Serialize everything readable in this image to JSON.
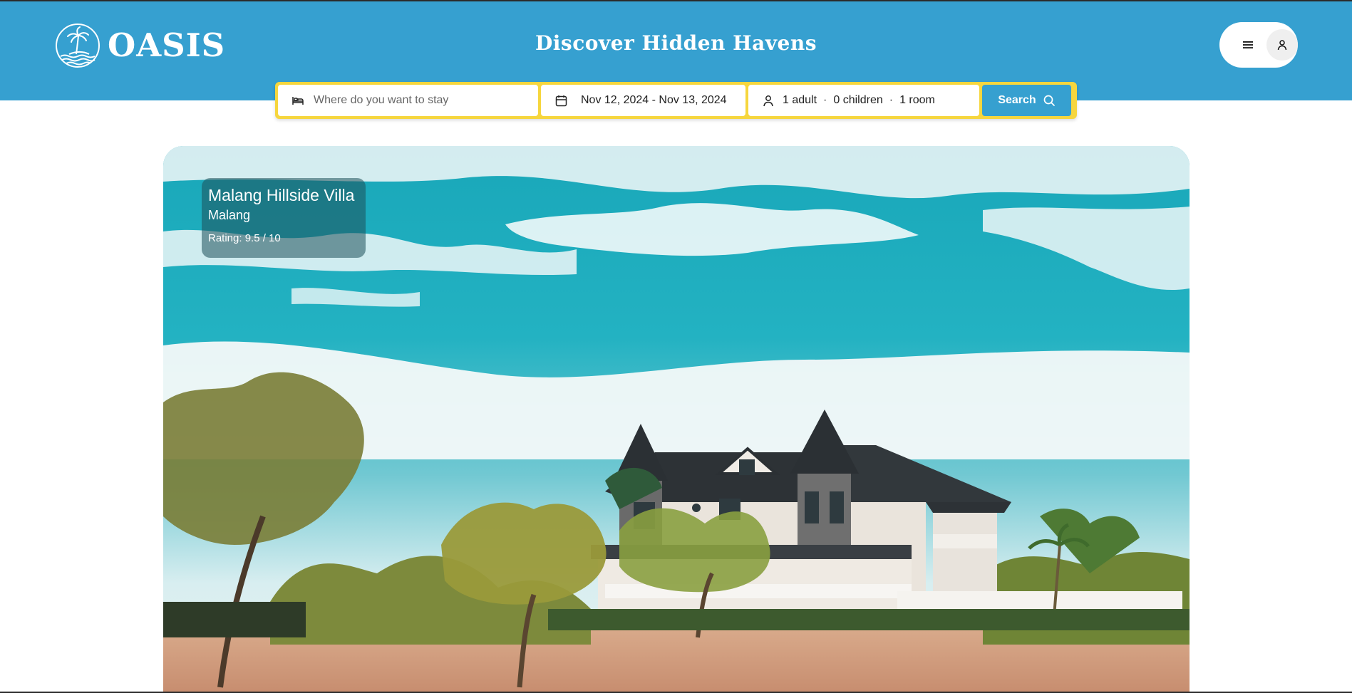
{
  "app": {
    "name": "OASIS",
    "page_title": "Discover Hidden Havens"
  },
  "header": {
    "menu_icon": "hamburger-menu-icon",
    "profile_icon": "user-icon"
  },
  "search": {
    "destination_placeholder": "Where do you want to stay",
    "destination_value": "",
    "dates": "Nov 12, 2024 - Nov 13, 2024",
    "adults": "1 adult",
    "children": "0 children",
    "rooms": "1 room",
    "separator": "·",
    "button_label": "Search"
  },
  "featured": {
    "name": "Malang Hillside Villa",
    "city": "Malang",
    "rating": "Rating: 9.5 / 10"
  },
  "colors": {
    "header_bg": "#36a0d0",
    "search_border": "#f6d63e",
    "search_button": "#36a0d0",
    "white": "#ffffff"
  }
}
